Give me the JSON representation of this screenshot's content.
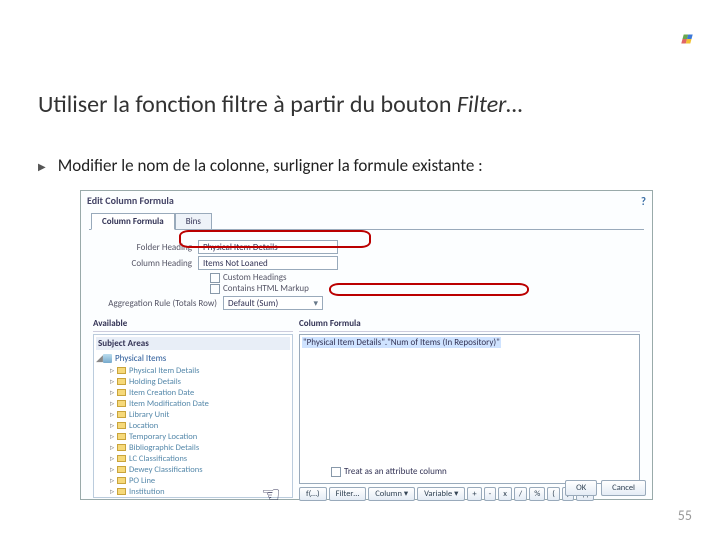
{
  "slide": {
    "title_prefix": "Utiliser la fonction filtre à partir du bouton ",
    "title_em": "Filter…",
    "subline": "Modifier le nom de la colonne, surligner la formule existante :",
    "page_number": "55"
  },
  "dialog": {
    "title": "Edit Column Formula",
    "help": "?",
    "tabs": {
      "active": "Column Formula",
      "other": "Bins"
    },
    "folder_heading_label": "Folder Heading",
    "folder_heading_value": "Physical Item Details",
    "column_heading_label": "Column Heading",
    "column_heading_value": "Items Not Loaned",
    "custom_headings": "Custom Headings",
    "contains_html": "Contains HTML Markup",
    "agg_label": "Aggregation Rule (Totals Row)",
    "agg_value": "Default (Sum)",
    "available_label": "Available",
    "subject_areas": "Subject Areas",
    "root": "Physical Items",
    "tree": [
      "Physical Item Details",
      "Holding Details",
      "Item Creation Date",
      "Item Modification Date",
      "Library Unit",
      "Location",
      "Temporary Location",
      "Bibliographic Details",
      "LC Classifications",
      "Dewey Classifications",
      "PO Line",
      "Institution"
    ],
    "formula_label": "Column Formula",
    "formula_value": "\"Physical Item Details\".\"Num of Items (In Repository)\"",
    "toolbar": {
      "fx": "f(…)",
      "filter": "Filter…",
      "column": "Column ▾",
      "variable": "Variable ▾",
      "plus": "+",
      "minus": "-",
      "mult": "x",
      "div": "/",
      "pct": "%",
      "lp": "(",
      "rp": ")",
      "pipe": "||"
    },
    "treat_attr": "Treat as an attribute column",
    "ok": "OK",
    "cancel": "Cancel"
  }
}
